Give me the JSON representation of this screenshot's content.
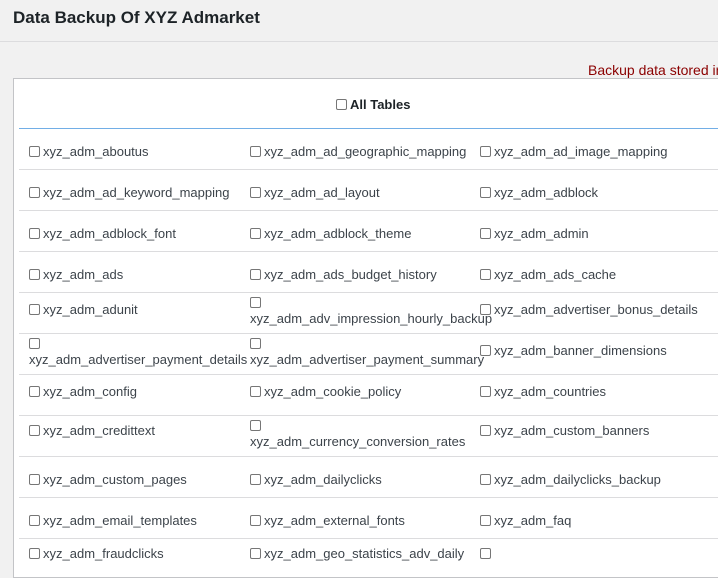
{
  "page": {
    "title": "Data Backup Of XYZ Admarket",
    "notice": "Backup data stored in"
  },
  "all_tables": {
    "label": "All Tables"
  },
  "tables": [
    [
      "xyz_adm_aboutus",
      "xyz_adm_ad_geographic_mapping",
      "xyz_adm_ad_image_mapping"
    ],
    [
      "xyz_adm_ad_keyword_mapping",
      "xyz_adm_ad_layout",
      "xyz_adm_adblock"
    ],
    [
      "xyz_adm_adblock_font",
      "xyz_adm_adblock_theme",
      "xyz_adm_admin"
    ],
    [
      "xyz_adm_ads",
      "xyz_adm_ads_budget_history",
      "xyz_adm_ads_cache"
    ],
    [
      "xyz_adm_adunit",
      "xyz_adm_adv_impression_hourly_backup",
      "xyz_adm_advertiser_bonus_details"
    ],
    [
      "xyz_adm_advertiser_payment_details",
      "xyz_adm_advertiser_payment_summary",
      "xyz_adm_banner_dimensions"
    ],
    [
      "xyz_adm_config",
      "xyz_adm_cookie_policy",
      "xyz_adm_countries"
    ],
    [
      "xyz_adm_credittext",
      "xyz_adm_currency_conversion_rates",
      "xyz_adm_custom_banners"
    ],
    [
      "xyz_adm_custom_pages",
      "xyz_adm_dailyclicks",
      "xyz_adm_dailyclicks_backup"
    ],
    [
      "xyz_adm_email_templates",
      "xyz_adm_external_fonts",
      "xyz_adm_faq"
    ],
    [
      "xyz_adm_fraudclicks",
      "xyz_adm_geo_statistics_adv_daily",
      ""
    ]
  ],
  "colors": {
    "notice": "#8b0000",
    "header_divider": "#72aee6",
    "background": "#f1f1f1"
  }
}
